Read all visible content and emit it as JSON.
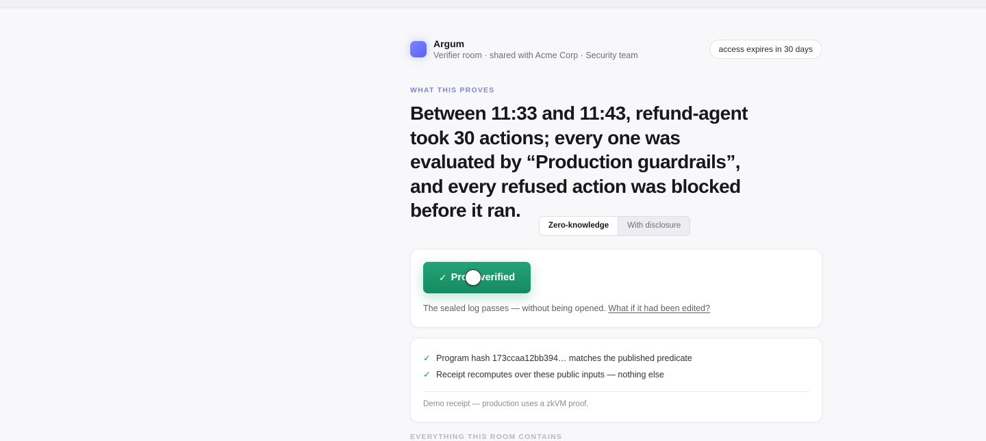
{
  "header": {
    "brand": "Argum",
    "subtitle": "Verifier room · shared with Acme Corp · Security team",
    "access_badge": "access expires in 30 days"
  },
  "claim": {
    "eyebrow": "WHAT THIS PROVES",
    "headline": "Between 11:33 and 11:43, refund-agent took 30 actions; every one was evaluated by “Production guardrails”, and every refused action was blocked before it ran."
  },
  "mode_toggle": {
    "options": [
      "Zero-knowledge",
      "With disclosure"
    ],
    "selected": "Zero-knowledge"
  },
  "verify_card": {
    "button_check": "✓",
    "button_label": "Proof verified",
    "description": "The sealed log passes — without being opened.",
    "link": "What if it had been edited?"
  },
  "checks_card": {
    "items": [
      "Program hash 173ccaa12bb394… matches the published predicate",
      "Receipt recomputes over these public inputs — nothing else"
    ],
    "tick": "✓",
    "note": "Demo receipt — production uses a zkVM proof."
  },
  "contents_section": {
    "label": "EVERYTHING THIS ROOM CONTAINS"
  },
  "colors": {
    "accent": "#6c74f5",
    "success": "#1a9268",
    "eyebrow": "#7f86c9"
  }
}
